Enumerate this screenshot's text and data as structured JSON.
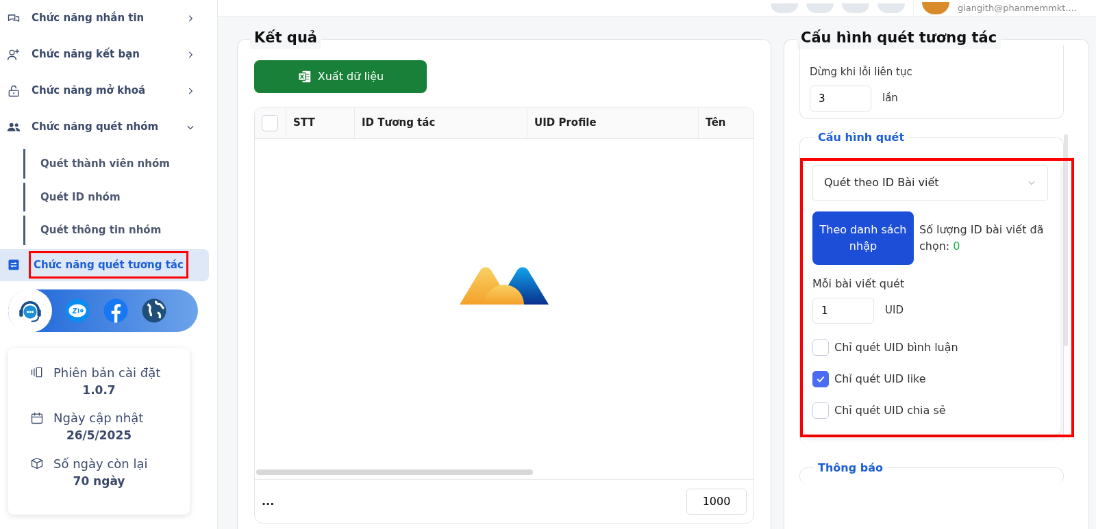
{
  "sidebar": {
    "items": [
      {
        "label": "Chức năng nhắn tin",
        "expanded": false,
        "selected": false,
        "highlighted": false
      },
      {
        "label": "Chức năng kết bạn",
        "expanded": false,
        "selected": false,
        "highlighted": false
      },
      {
        "label": "Chức năng mở khoá",
        "expanded": false,
        "selected": false,
        "highlighted": false
      },
      {
        "label": "Chức năng quét nhóm",
        "expanded": true,
        "selected": false,
        "highlighted": false,
        "children": [
          {
            "label": "Quét thành viên nhóm",
            "selected": false
          },
          {
            "label": "Quét ID nhóm",
            "selected": false
          },
          {
            "label": "Quét thông tin nhóm",
            "selected": false
          }
        ]
      },
      {
        "label": "Chức năng quét tương tác",
        "expanded": false,
        "selected": true,
        "highlighted": true
      }
    ],
    "info": [
      {
        "label": "Phiên bản cài đặt",
        "value": "1.0.7"
      },
      {
        "label": "Ngày cập nhật",
        "value": "26/5/2025"
      },
      {
        "label": "Số ngày còn lại",
        "value": "70 ngày"
      }
    ]
  },
  "header": {
    "email": "giangith@phanmemmkt...."
  },
  "results": {
    "title": "Kết quả",
    "export_button": "Xuất dữ liệu",
    "table": {
      "select_all_checked": false,
      "columns": [
        "STT",
        "ID Tương tác",
        "UID Profile",
        "Tên"
      ]
    },
    "footer_text": "...",
    "page_size": "1000"
  },
  "config": {
    "title": "Cấu hình quét tương tác",
    "stop_on_error": {
      "label": "Dừng khi lỗi liên tục",
      "value": "3",
      "unit": "lần"
    },
    "scan": {
      "title": "Cấu hình quét",
      "highlighted": true,
      "mode": "Quét theo ID Bài viết",
      "list_button": "Theo danh sách nhập",
      "count_label": "Số lượng ID bài viết đã chọn:",
      "count": "0",
      "per_post_label": "Mỗi bài viết quét",
      "per_post_value": "1",
      "per_post_unit": "UID",
      "options": [
        {
          "label": "Chỉ quét UID bình luận",
          "checked": false
        },
        {
          "label": "Chỉ quét UID like",
          "checked": true
        },
        {
          "label": "Chỉ quét UID chia sẻ",
          "checked": false
        }
      ]
    },
    "notify_title": "Thông báo"
  }
}
